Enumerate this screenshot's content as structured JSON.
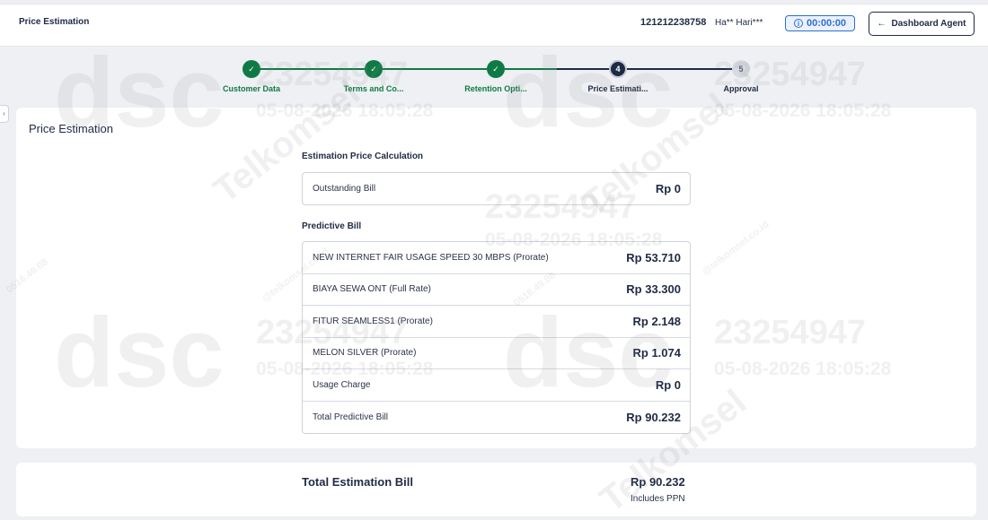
{
  "header": {
    "title": "Price Estimation",
    "msisdn": "121212238758",
    "customer_name": "Ha** Hari***",
    "timer": "00:00:00",
    "dashboard_button": "Dashboard Agent"
  },
  "stepper": {
    "steps": [
      {
        "number": "1",
        "label": "Customer Data",
        "state": "done"
      },
      {
        "number": "2",
        "label": "Terms and Co...",
        "state": "done"
      },
      {
        "number": "3",
        "label": "Retention Opti...",
        "state": "done"
      },
      {
        "number": "4",
        "label": "Price Estimati...",
        "state": "active"
      },
      {
        "number": "5",
        "label": "Approval",
        "state": "pending"
      }
    ],
    "colors": {
      "done": "#0f7a45",
      "active": "#1f2a44",
      "pending": "#d7dae1"
    }
  },
  "main": {
    "section_title": "Price Estimation",
    "calc_heading": "Estimation Price Calculation",
    "outstanding": {
      "label": "Outstanding Bill",
      "amount": "Rp  0"
    },
    "predictive_heading": "Predictive Bill",
    "predictive_rows": [
      {
        "label": "NEW INTERNET FAIR USAGE SPEED 30 MBPS (Prorate)",
        "amount": "Rp  53.710"
      },
      {
        "label": "BIAYA SEWA ONT (Full Rate)",
        "amount": "Rp  33.300"
      },
      {
        "label": "FITUR SEAMLESS1 (Prorate)",
        "amount": "Rp  2.148"
      },
      {
        "label": "MELON SILVER (Prorate)",
        "amount": "Rp  1.074"
      },
      {
        "label": "Usage Charge",
        "amount": "Rp  0"
      },
      {
        "label": "Total Predictive Bill",
        "amount": "Rp  90.232"
      }
    ]
  },
  "total": {
    "label": "Total Estimation Bill",
    "amount": "Rp  90.232",
    "note": "Includes PPN"
  },
  "watermark": {
    "brand": "dsc",
    "logo_text": "Telkomsel",
    "id": "23254947",
    "datetime": "05-08-2026 18:05:28",
    "email_text": "@telkomsel.co.id",
    "ip_text": "0516.49.08"
  }
}
